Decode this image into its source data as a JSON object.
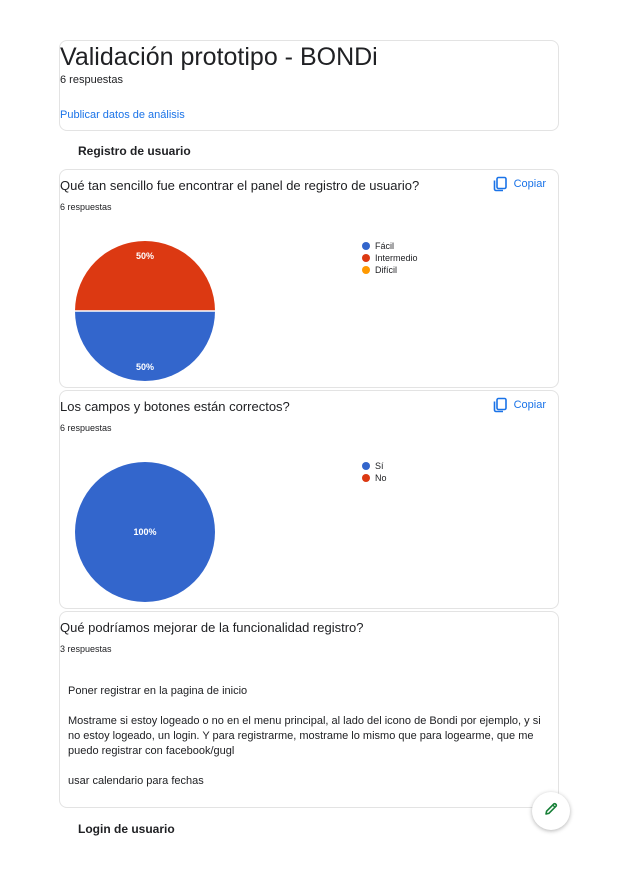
{
  "header": {
    "title": "Validación prototipo - BONDi",
    "responses": "6 respuestas",
    "publish_link": "Publicar datos de análisis"
  },
  "sections": {
    "registro": "Registro de usuario",
    "login": "Login de usuario"
  },
  "copy_label": "Copiar",
  "q1": {
    "title": "Qué tan sencillo fue encontrar el panel de registro de usuario?",
    "responses": "6 respuestas",
    "legend": [
      "Fácil",
      "Intermedio",
      "Difícil"
    ],
    "slice_labels": [
      "50%",
      "50%"
    ]
  },
  "q2": {
    "title": "Los campos y botones están correctos?",
    "responses": "6 respuestas",
    "legend": [
      "Sí",
      "No"
    ],
    "slice_labels": [
      "100%"
    ]
  },
  "q3": {
    "title": "Qué podríamos mejorar de la funcionalidad registro?",
    "responses": "3 respuestas",
    "answers": [
      "Poner registrar en la pagina de inicio",
      "Mostrame si estoy logeado o no en el menu principal, al lado del icono de Bondi por ejemplo, y si no estoy logeado, un login. Y para registrarme, mostrame lo mismo que para logearme, que me puedo registrar con facebook/gugl",
      "usar calendario para fechas"
    ]
  },
  "colors": {
    "blue": "#3366cc",
    "red": "#dc3912",
    "orange": "#ff9900",
    "link": "#1a73e8",
    "fab_icon": "#188038"
  },
  "icons": {
    "copy": "copy-icon",
    "fab": "pencil-icon"
  },
  "chart_data": [
    {
      "type": "pie",
      "categories": [
        "Fácil",
        "Intermedio",
        "Difícil"
      ],
      "values": [
        50,
        50,
        0
      ],
      "labels": [
        "50%",
        "50%"
      ],
      "legend": "right"
    },
    {
      "type": "pie",
      "categories": [
        "Sí",
        "No"
      ],
      "values": [
        100,
        0
      ],
      "labels": [
        "100%"
      ],
      "legend": "right"
    }
  ]
}
